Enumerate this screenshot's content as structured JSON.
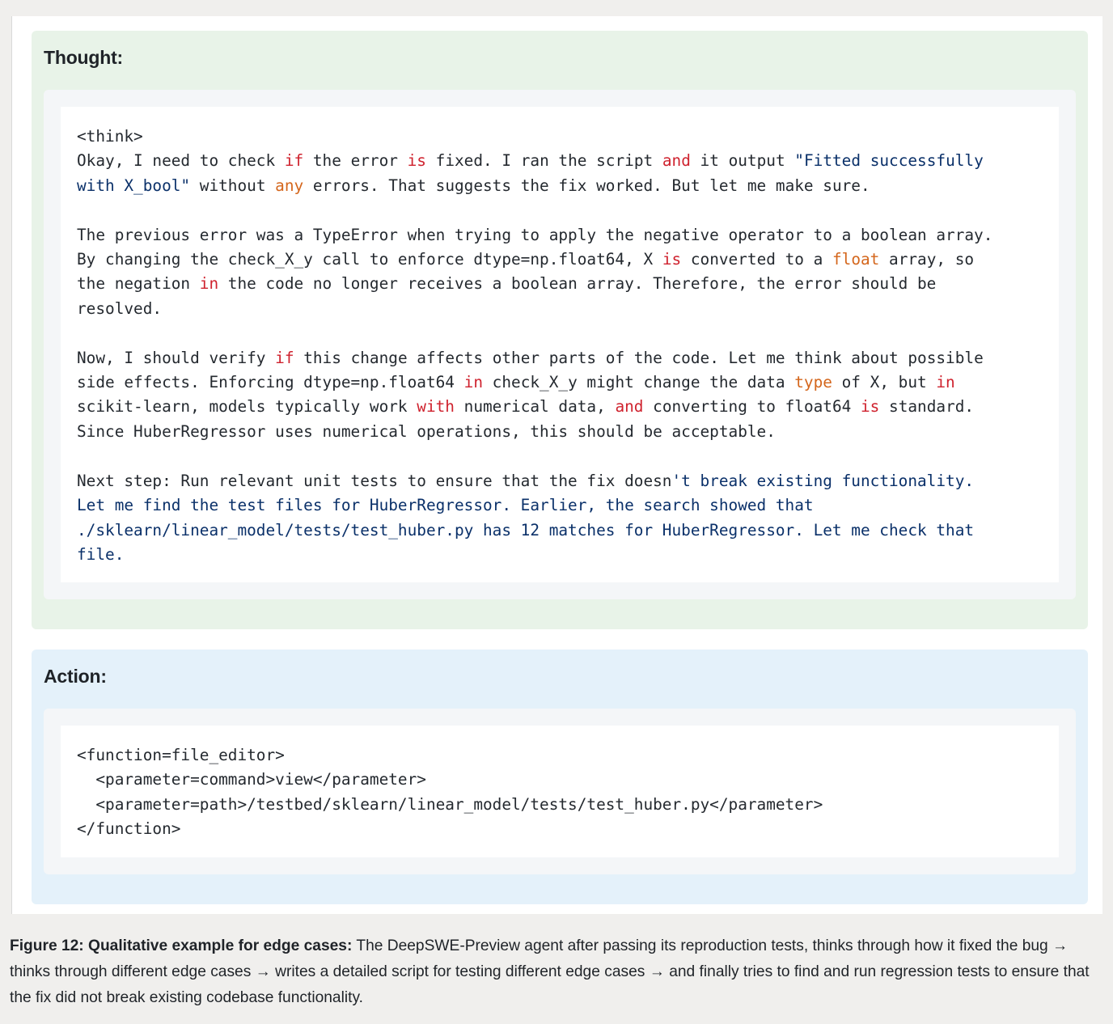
{
  "thought": {
    "title": "Thought:",
    "lines": [
      [
        {
          "t": "<think>",
          "c": ""
        }
      ],
      [
        {
          "t": "Okay, I need to check ",
          "c": ""
        },
        {
          "t": "if",
          "c": "kw"
        },
        {
          "t": " the error ",
          "c": ""
        },
        {
          "t": "is",
          "c": "kw"
        },
        {
          "t": " fixed. I ran the script ",
          "c": ""
        },
        {
          "t": "and",
          "c": "kw"
        },
        {
          "t": " it output ",
          "c": ""
        },
        {
          "t": "\"Fitted successfully",
          "c": "st"
        }
      ],
      [
        {
          "t": "with X_bool\"",
          "c": "st"
        },
        {
          "t": " without ",
          "c": ""
        },
        {
          "t": "any",
          "c": "bi"
        },
        {
          "t": " errors. That suggests the fix worked. But let me make sure.",
          "c": ""
        }
      ],
      [
        {
          "t": "",
          "c": ""
        }
      ],
      [
        {
          "t": "The previous error was a TypeError when trying to apply the negative operator to a boolean array.",
          "c": ""
        }
      ],
      [
        {
          "t": "By changing the check_X_y call to enforce dtype=np.float64, X ",
          "c": ""
        },
        {
          "t": "is",
          "c": "kw"
        },
        {
          "t": " converted to a ",
          "c": ""
        },
        {
          "t": "float",
          "c": "bi"
        },
        {
          "t": " array, so",
          "c": ""
        }
      ],
      [
        {
          "t": "the negation ",
          "c": ""
        },
        {
          "t": "in",
          "c": "kw"
        },
        {
          "t": " the code no longer receives a boolean array. Therefore, the error should be",
          "c": ""
        }
      ],
      [
        {
          "t": "resolved.",
          "c": ""
        }
      ],
      [
        {
          "t": "",
          "c": ""
        }
      ],
      [
        {
          "t": "Now, I should verify ",
          "c": ""
        },
        {
          "t": "if",
          "c": "kw"
        },
        {
          "t": " this change affects other parts of the code. Let me think about possible",
          "c": ""
        }
      ],
      [
        {
          "t": "side effects. Enforcing dtype=np.float64 ",
          "c": ""
        },
        {
          "t": "in",
          "c": "kw"
        },
        {
          "t": " check_X_y might change the data ",
          "c": ""
        },
        {
          "t": "type",
          "c": "bi"
        },
        {
          "t": " of X, but ",
          "c": ""
        },
        {
          "t": "in",
          "c": "kw"
        }
      ],
      [
        {
          "t": "scikit-learn, models typically work ",
          "c": ""
        },
        {
          "t": "with",
          "c": "kw"
        },
        {
          "t": " numerical data, ",
          "c": ""
        },
        {
          "t": "and",
          "c": "kw"
        },
        {
          "t": " converting to float64 ",
          "c": ""
        },
        {
          "t": "is",
          "c": "kw"
        },
        {
          "t": " standard.",
          "c": ""
        }
      ],
      [
        {
          "t": "Since HuberRegressor uses numerical operations, this should be acceptable.",
          "c": ""
        }
      ],
      [
        {
          "t": "",
          "c": ""
        }
      ],
      [
        {
          "t": "Next step: Run relevant unit tests to ensure that the fix doesn",
          "c": ""
        },
        {
          "t": "'t break existing functionality.",
          "c": "st"
        }
      ],
      [
        {
          "t": "Let me find the test files for HuberRegressor. Earlier, the search showed that",
          "c": "st"
        }
      ],
      [
        {
          "t": "./sklearn/linear_model/tests/test_huber.py has 12 matches for HuberRegressor. Let me check that",
          "c": "st"
        }
      ],
      [
        {
          "t": "file.",
          "c": "st"
        }
      ]
    ]
  },
  "action": {
    "title": "Action:",
    "lines": [
      [
        {
          "t": "<function=file_editor>",
          "c": ""
        }
      ],
      [
        {
          "t": "  <parameter=command>view</parameter>",
          "c": ""
        }
      ],
      [
        {
          "t": "  <parameter=path>/testbed/sklearn/linear_model/tests/test_huber.py</parameter>",
          "c": ""
        }
      ],
      [
        {
          "t": "</function>",
          "c": ""
        }
      ]
    ]
  },
  "caption": {
    "label": "Figure 12: Qualitative example for edge cases:",
    "text": " The DeepSWE-Preview agent after passing its reproduction tests, thinks through how it fixed the bug → thinks through different edge cases → writes a detailed script for testing different edge cases → and finally tries to find and run regression tests to ensure that the fix did not break existing codebase functionality."
  },
  "colors": {
    "keyword": "#cf222e",
    "builtin": "#d4661c",
    "string": "#0a3069",
    "thought_panel_bg": "#e8f3e8",
    "action_panel_bg": "#e4f1fa"
  }
}
